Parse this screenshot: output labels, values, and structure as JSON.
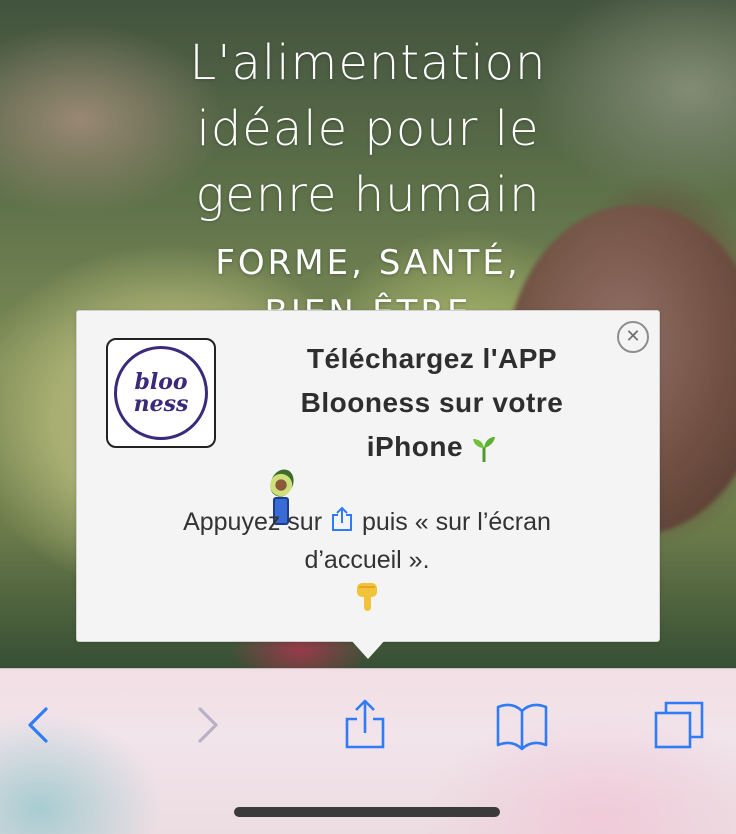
{
  "hero": {
    "title_lines": [
      "L'alimentation",
      "idéale pour le",
      "genre humain"
    ],
    "subtitle_lines": [
      "FORME, SANTÉ,",
      "BIEN-ÊTRE"
    ]
  },
  "popup": {
    "logo_lines": [
      "bloo",
      "ness"
    ],
    "heading_lines": [
      "Téléchargez l'APP",
      "Blooness sur votre",
      "iPhone"
    ],
    "heading_emojis": [
      "seedling-icon",
      "avocado-icon",
      "mobile-phone-icon"
    ],
    "body_before_icon": "Appuyez sur ",
    "body_after_icon": " puis « sur l’écran",
    "body_line2": "d’accueil ».",
    "close_glyph": "✕",
    "pointing_emoji": "pointing-down-icon"
  },
  "toolbar": {
    "buttons": [
      "back-icon",
      "forward-icon",
      "share-icon",
      "bookmarks-icon",
      "tabs-icon"
    ]
  },
  "colors": {
    "toolbar_icon_active": "#2f7cf6",
    "toolbar_icon_disabled": "#b9b2c6",
    "popup_background": "#f4f4f4",
    "logo_accent": "#3b2a7a"
  }
}
